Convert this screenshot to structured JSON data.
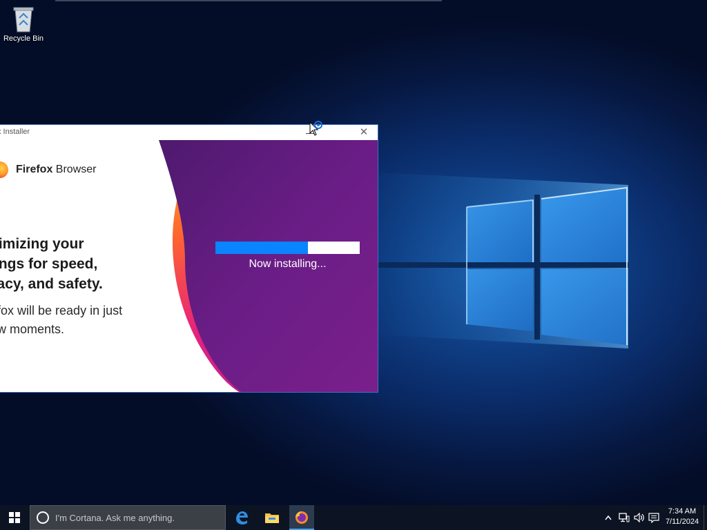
{
  "desktop": {
    "icons": [
      {
        "label": "Recycle Bin",
        "icon": "recycle-bin-icon"
      }
    ]
  },
  "installer": {
    "title": "x Installer",
    "brand": {
      "bold": "Firefox",
      "regular": " Browser"
    },
    "headline": "ptimizing your\nttings for speed,\nivacy, and safety.",
    "subtext": "efox will be ready in just\new moments.",
    "progress": 0.64,
    "status": "Now installing...",
    "colors": {
      "progress": "#0a84ff",
      "purple": "#5a1a7a",
      "accent_orange": "#ff7a2a",
      "accent_pink": "#e0237a"
    }
  },
  "taskbar": {
    "search_placeholder": "I'm Cortana. Ask me anything.",
    "pinned": [
      {
        "name": "edge-icon",
        "active": false
      },
      {
        "name": "file-explorer-icon",
        "active": false
      },
      {
        "name": "firefox-icon",
        "active": true
      }
    ],
    "tray": [
      "chevron-up-icon",
      "network-icon",
      "volume-icon",
      "notifications-icon"
    ],
    "time": "7:34 AM",
    "date": "7/11/2024"
  }
}
